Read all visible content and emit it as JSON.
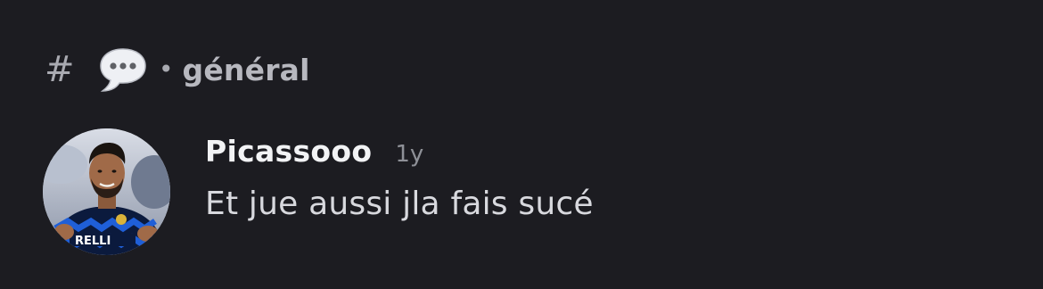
{
  "channel": {
    "hash_symbol": "#",
    "emoji_icon": "speech-bubble-icon",
    "separator": "•",
    "name": "général"
  },
  "message": {
    "author": "Picassooo",
    "timestamp": "1y",
    "text": "Et jue aussi jla fais sucé",
    "avatar_icon": "user-avatar-photo",
    "avatar_jersey_text": "RELLI"
  },
  "colors": {
    "background": "#1c1c21",
    "username": "#f2f3f5",
    "message_text": "#d8d9de",
    "muted": "#8e9097",
    "channel_name": "#b7b8bf"
  }
}
